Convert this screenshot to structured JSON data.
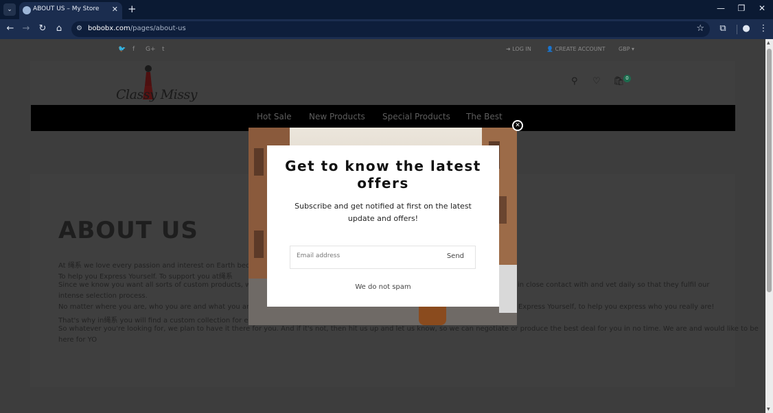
{
  "browser": {
    "tab_title": "ABOUT US – My Store",
    "url_host": "bobobx.com",
    "url_path": "/pages/about-us",
    "icons": {
      "tab_list": "chevron-down-icon",
      "close_tab": "close-icon",
      "new_tab": "plus-icon",
      "minimize": "minimize-icon",
      "maximize": "maximize-icon",
      "close_window": "close-icon",
      "back": "arrow-left-icon",
      "forward": "arrow-right-icon",
      "reload": "reload-icon",
      "home": "home-icon",
      "site_info": "tune-icon",
      "bookmark": "star-icon",
      "extensions": "puzzle-icon",
      "profile": "person-icon",
      "menu": "kebab-icon"
    }
  },
  "header": {
    "social": [
      "twitter-icon",
      "facebook-icon",
      "google-plus-icon",
      "tumblr-icon"
    ],
    "login_label": "LOG IN",
    "create_account_label": "CREATE ACCOUNT",
    "currency": "GBP",
    "logo_text": "Classy Missy",
    "cart_count": "0"
  },
  "menu": {
    "items": [
      "Hot Sale",
      "New Products",
      "Special Products",
      "The Best"
    ]
  },
  "content": {
    "title": "ABOUT US",
    "lines": [
      "At 绳系 we love every passion and interest on Earth because",
      "To help you Express Yourself. To support you at绳系",
      "Since we know you want all sorts of custom products, we go",
      "intense selection process.",
      "No matter where you are, who you are and what you are pa",
      "That's why in绳系 you will find a custom collection for every",
      "So whatever you're looking for, we plan to have it there for you. And if it's not, then hit us up and let us know, so we can negotiate or produce the best deal for you in no time. We are and would like to be",
      "here for YO"
    ],
    "right_fragments": [
      "in close contact with and vet daily so that they fulfil our",
      "Express Yourself, to help you express who you really are!"
    ]
  },
  "popup": {
    "title": "Get to know the latest offers",
    "subtitle": "Subscribe and get notified at first on the latest update and offers!",
    "email_placeholder": "Email address",
    "send_label": "Send",
    "note": "We do not spam"
  }
}
